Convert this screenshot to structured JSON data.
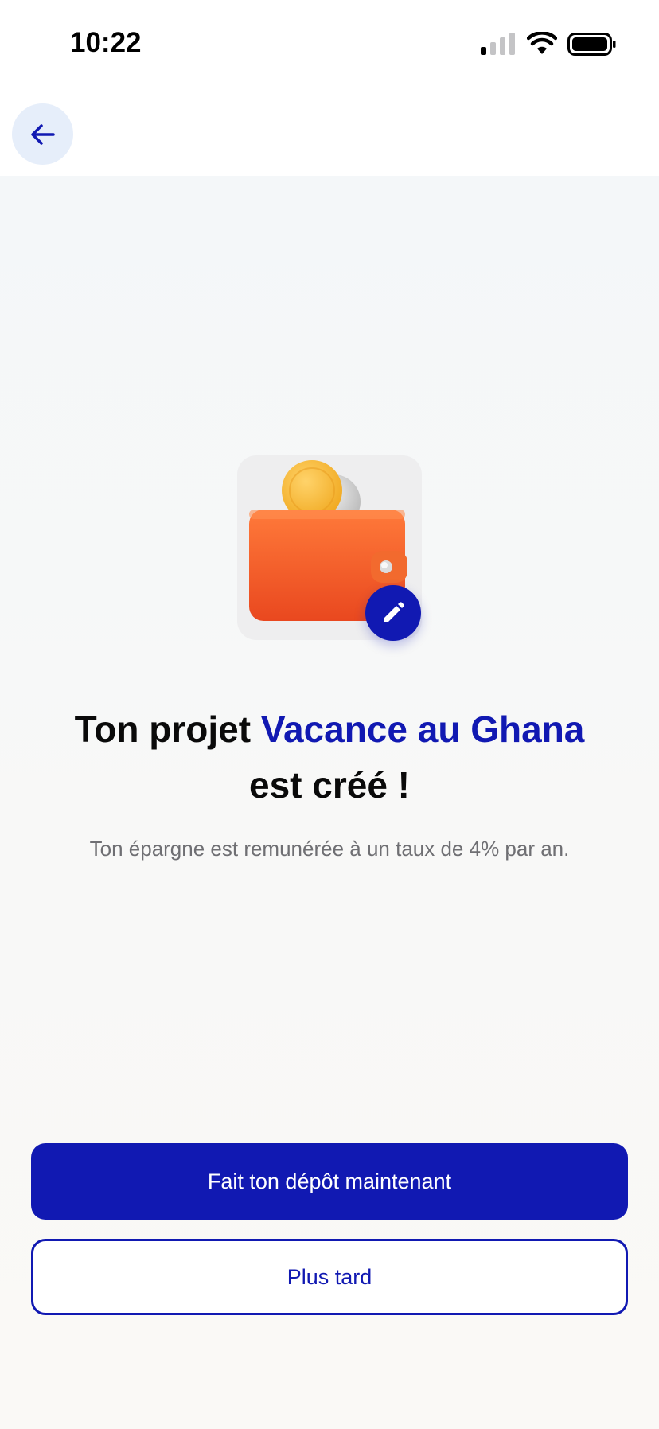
{
  "status_bar": {
    "time": "10:22",
    "icons": [
      "cellular-signal-icon",
      "wifi-icon",
      "battery-icon"
    ]
  },
  "header": {
    "back_icon": "arrow-left-icon"
  },
  "illustration": {
    "image": "wallet-with-coins-icon",
    "edit_icon": "pencil-icon"
  },
  "title": {
    "prefix": "Ton projet ",
    "project_name": "Vacance au Ghana",
    "suffix": "est créé !"
  },
  "subtitle": "Ton épargne est remunérée à un taux de 4% par an.",
  "buttons": {
    "primary_label": "Fait ton dépôt maintenant",
    "secondary_label": "Plus tard"
  },
  "colors": {
    "accent": "#1119b2",
    "back_button_bg": "#e6eefa",
    "wallet": "#f05a24",
    "coin": "#f7b733"
  }
}
